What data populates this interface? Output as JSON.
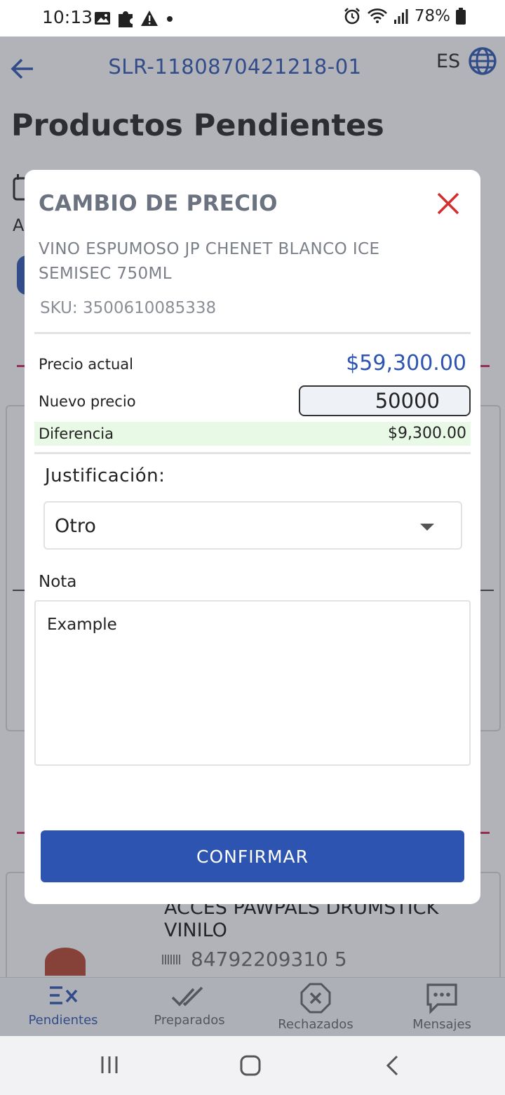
{
  "status_bar": {
    "time": "10:13",
    "battery": "78%",
    "left_icons": [
      "image-icon",
      "puzzle-icon",
      "warning-icon",
      "dot-icon"
    ],
    "right_icons": [
      "alarm-icon",
      "wifi-icon",
      "signal-icon",
      "battery-icon"
    ]
  },
  "header": {
    "order_id": "SLR-1180870421218-01",
    "language": "ES",
    "back_icon": "arrow-left-icon",
    "lang_icon": "globe-icon"
  },
  "page": {
    "title": "Productos Pendientes",
    "partial_letter": "A"
  },
  "background_card": {
    "product_name": "ACCES PAWPALS DRUMSTICK VINILO",
    "sku": "84792209310 5"
  },
  "modal": {
    "title": "CAMBIO DE PRECIO",
    "product_name": "VINO ESPUMOSO JP CHENET BLANCO ICE SEMISEC 750ML",
    "sku": "SKU: 3500610085338",
    "current_price_label": "Precio actual",
    "current_price": "$59,300.00",
    "new_price_label": "Nuevo precio",
    "new_price_value": "50000",
    "difference_label": "Diferencia",
    "difference_value": "$9,300.00",
    "justification_label": "Justificación:",
    "justification_value": "Otro",
    "note_label": "Nota",
    "note_value": "Example",
    "confirm_label": "CONFIRMAR"
  },
  "bottom_nav": {
    "items": [
      {
        "label": "Pendientes",
        "icon": "pending-list-icon",
        "active": true
      },
      {
        "label": "Preparados",
        "icon": "double-check-icon",
        "active": false
      },
      {
        "label": "Rechazados",
        "icon": "rejected-x-icon",
        "active": false
      },
      {
        "label": "Mensajes",
        "icon": "chat-bubble-icon",
        "active": false
      }
    ]
  },
  "colors": {
    "primary": "#2c54b0",
    "close_red": "#d32f2f",
    "difference_bg": "#e8f9e5",
    "accent_line": "#d02050"
  }
}
